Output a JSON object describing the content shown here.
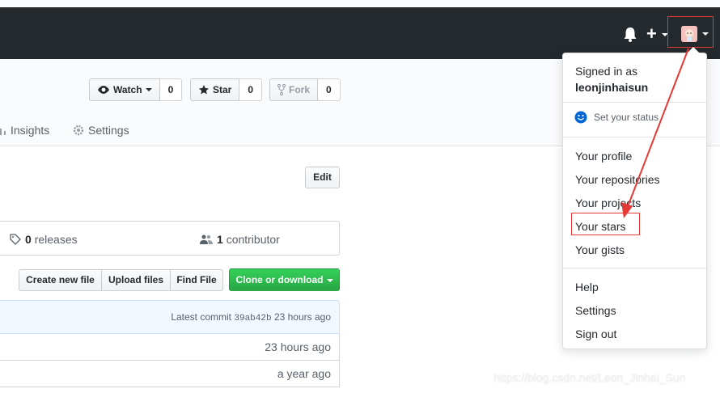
{
  "header": {
    "icons": [
      "bell-icon",
      "plus-icon",
      "avatar"
    ]
  },
  "repo_actions": {
    "watch": {
      "label": "Watch",
      "count": "0"
    },
    "star": {
      "label": "Star",
      "count": "0"
    },
    "fork": {
      "label": "Fork",
      "count": "0"
    }
  },
  "tabs": {
    "insights": "Insights",
    "settings": "Settings"
  },
  "edit_label": "Edit",
  "summary": {
    "releases_count": "0",
    "releases_label": "releases",
    "contributors_count": "1",
    "contributors_label": "contributor"
  },
  "file_buttons": {
    "create": "Create new file",
    "upload": "Upload files",
    "find": "Find File",
    "clone": "Clone or download"
  },
  "latest_commit": {
    "prefix": "Latest commit",
    "sha": "39ab42b",
    "age": "23 hours ago"
  },
  "file_rows": [
    {
      "age": "23 hours ago"
    },
    {
      "age": "a year ago"
    }
  ],
  "user_menu": {
    "signed_in_as": "Signed in as",
    "username": "leonjinhaisun",
    "set_status": "Set your status",
    "items_group1": [
      "Your profile",
      "Your repositories",
      "Your projects",
      "Your stars",
      "Your gists"
    ],
    "items_group2": [
      "Help",
      "Settings",
      "Sign out"
    ]
  },
  "watermark": "https://blog.csdn.net/Leon_Jinhai_Sun",
  "colors": {
    "header_bg": "#24292e",
    "clone_green": "#28a745",
    "annotation_red": "#e53935"
  }
}
